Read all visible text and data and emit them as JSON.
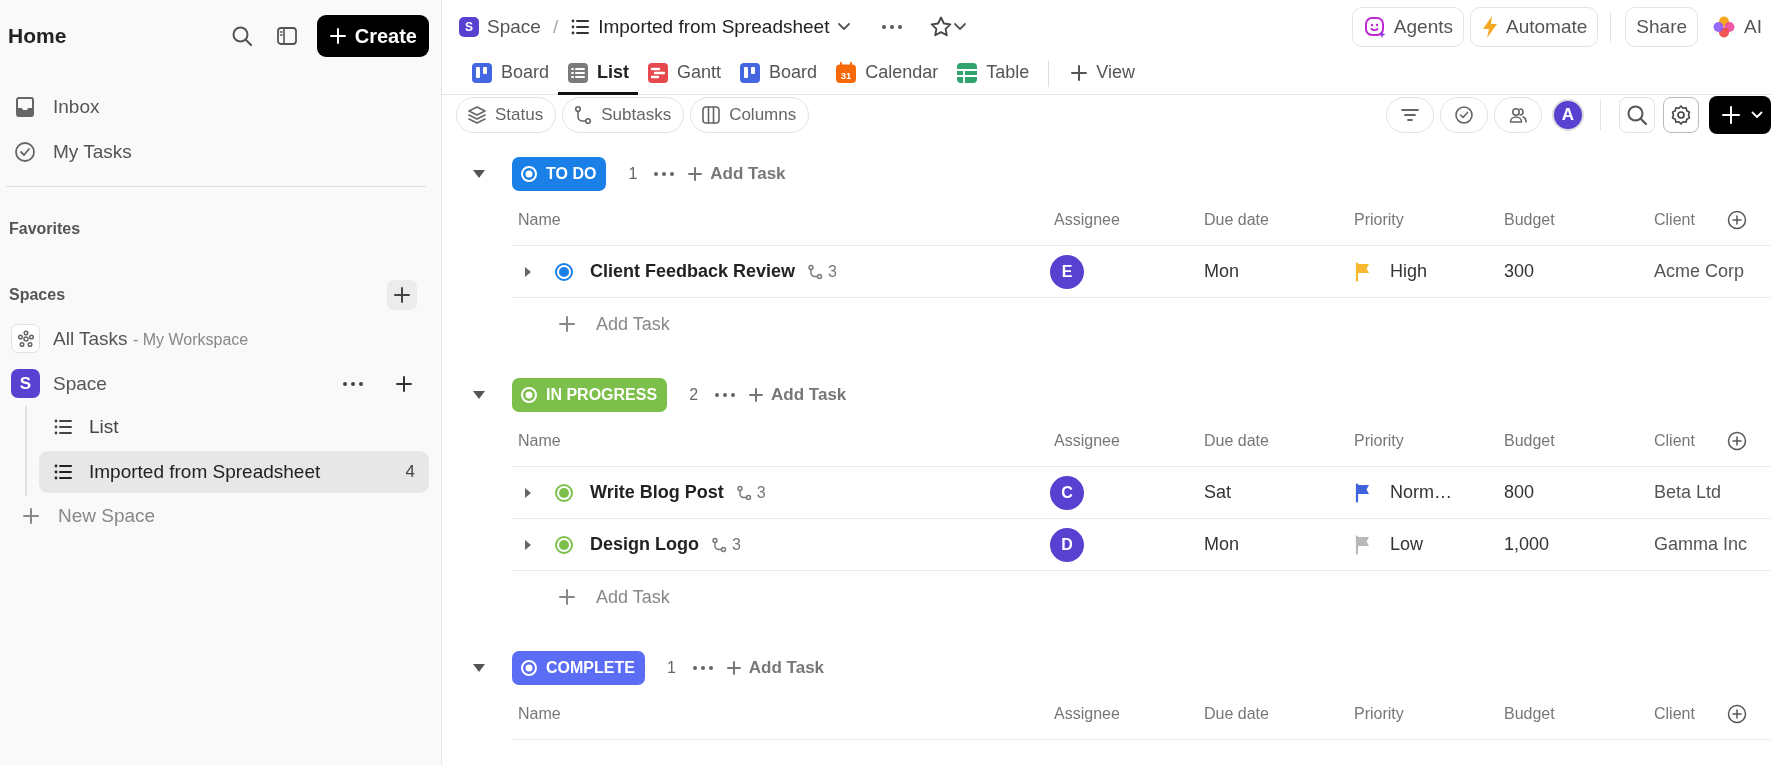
{
  "sidebar": {
    "title": "Home",
    "create_button": "Create",
    "nav": [
      {
        "label": "Inbox",
        "kind": "inbox"
      },
      {
        "label": "My Tasks",
        "kind": "tasks"
      }
    ],
    "favorites_heading": "Favorites",
    "spaces_heading": "Spaces",
    "all_tasks": {
      "label": "All Tasks",
      "suffix": "- My Workspace"
    },
    "space": {
      "badge": "S",
      "label": "Space",
      "lists": [
        {
          "label": "List",
          "selected": false
        },
        {
          "label": "Imported from Spreadsheet",
          "count": "4",
          "selected": true
        }
      ]
    },
    "new_space": "New Space"
  },
  "header": {
    "breadcrumb": {
      "space_badge": "S",
      "space": "Space",
      "separator": "/",
      "list": "Imported from Spreadsheet"
    },
    "buttons": [
      {
        "label": "Agents",
        "kind": "agents"
      },
      {
        "label": "Automate",
        "kind": "automate"
      },
      {
        "label": "Share",
        "kind": "share"
      }
    ],
    "ai": "AI"
  },
  "tabs": [
    {
      "label": "Board",
      "kind": "board",
      "color": "#4466e0",
      "selected": false
    },
    {
      "label": "List",
      "kind": "list",
      "color": "#7a7a7a",
      "selected": true
    },
    {
      "label": "Gantt",
      "kind": "gantt",
      "color": "#e5484d",
      "selected": false
    },
    {
      "label": "Board",
      "kind": "board",
      "color": "#4466e0",
      "selected": false
    },
    {
      "label": "Calendar",
      "kind": "calendar",
      "color": "#f76808",
      "badge": "31",
      "selected": false
    },
    {
      "label": "Table",
      "kind": "table",
      "color": "#30a46c",
      "selected": false
    }
  ],
  "add_view": "View",
  "toolbar": {
    "chips": [
      {
        "label": "Status",
        "kind": "status"
      },
      {
        "label": "Subtasks",
        "kind": "subtasks"
      },
      {
        "label": "Columns",
        "kind": "columns"
      }
    ],
    "user_avatar": "A"
  },
  "groups": [
    {
      "name": "TO DO",
      "color": "#1a7fe6",
      "count": "1",
      "add_task": "Add Task",
      "columns": [
        "Name",
        "Assignee",
        "Due date",
        "Priority",
        "Budget",
        "Client"
      ],
      "tasks": [
        {
          "name": "Client Feedback Review",
          "subtasks": "3",
          "assignee": "E",
          "due": "Mon",
          "priority": {
            "label": "High",
            "color": "#f5b82e"
          },
          "budget": "300",
          "client": "Acme Corp"
        }
      ],
      "add_row": "Add Task"
    },
    {
      "name": "IN PROGRESS",
      "color": "#7cbf4a",
      "count": "2",
      "add_task": "Add Task",
      "columns": [
        "Name",
        "Assignee",
        "Due date",
        "Priority",
        "Budget",
        "Client"
      ],
      "tasks": [
        {
          "name": "Write Blog Post",
          "subtasks": "3",
          "assignee": "C",
          "due": "Sat",
          "priority": {
            "label": "Norm…",
            "color": "#3e63dd"
          },
          "budget": "800",
          "client": "Beta Ltd"
        },
        {
          "name": "Design Logo",
          "subtasks": "3",
          "assignee": "D",
          "due": "Mon",
          "priority": {
            "label": "Low",
            "color": "#b8b8b8"
          },
          "budget": "1,000",
          "client": "Gamma Inc"
        }
      ],
      "add_row": "Add Task"
    },
    {
      "name": "COMPLETE",
      "color": "#5b6cf5",
      "count": "1",
      "add_task": "Add Task",
      "columns": [
        "Name",
        "Assignee",
        "Due date",
        "Priority",
        "Budget",
        "Client"
      ]
    }
  ]
}
